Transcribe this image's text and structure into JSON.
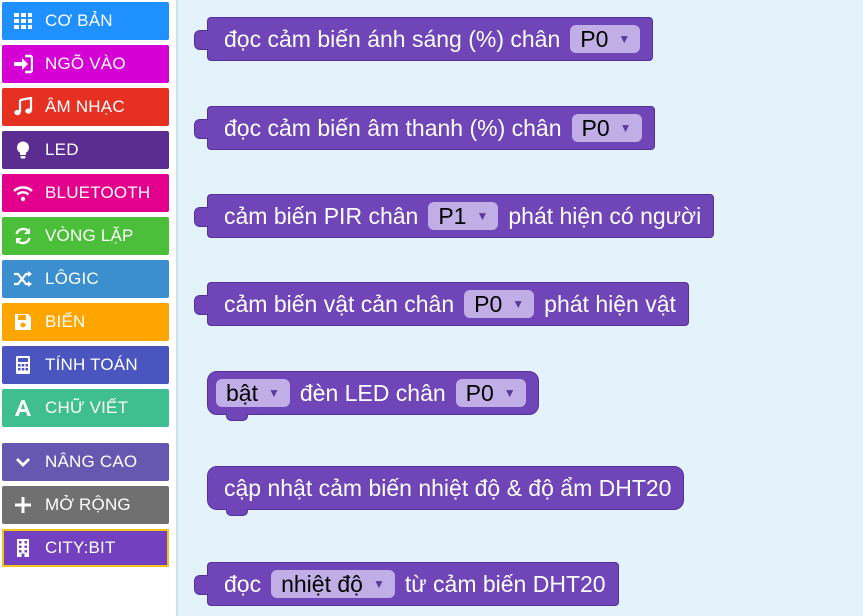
{
  "categories": [
    {
      "label": "CƠ BẢN",
      "icon": "grid-icon",
      "color": "#1e90ff"
    },
    {
      "label": "NGÕ VÀO",
      "icon": "sign-in-icon",
      "color": "#d400d4"
    },
    {
      "label": "ÂM NHẠC",
      "icon": "music-note-icon",
      "color": "#e63022"
    },
    {
      "label": "LED",
      "icon": "lightbulb-icon",
      "color": "#5c2d91"
    },
    {
      "label": "BLUETOOTH",
      "icon": "wifi-icon",
      "color": "#e3008c"
    },
    {
      "label": "VÒNG LẶP",
      "icon": "refresh-icon",
      "color": "#4cbf3a"
    },
    {
      "label": "LÔGIC",
      "icon": "shuffle-icon",
      "color": "#3c8fce"
    },
    {
      "label": "BIẾN",
      "icon": "save-icon",
      "color": "#ffa500"
    },
    {
      "label": "TÍNH TOÁN",
      "icon": "calculator-icon",
      "color": "#4a55c0"
    },
    {
      "label": "CHỮ VIẾT",
      "icon": "letter-a-icon",
      "color": "#3fbf8f"
    },
    {
      "label": "NÂNG CAO",
      "icon": "chevron-down-icon",
      "color": "#6658b0"
    },
    {
      "label": "MỞ RỘNG",
      "icon": "plus-icon",
      "color": "#707070"
    },
    {
      "label": "CITY:BIT",
      "icon": "building-icon",
      "color": "#7340c0",
      "selected": true
    }
  ],
  "blocks": {
    "light": {
      "text": "đọc cảm biến ánh sáng (%) chân",
      "pin": "P0"
    },
    "sound": {
      "text": "đọc cảm biến âm thanh (%) chân",
      "pin": "P0"
    },
    "pir": {
      "text1": "cảm biến PIR chân",
      "pin": "P1",
      "text2": "phát hiện có người"
    },
    "obstacle": {
      "text1": "cảm biến vật cản chân",
      "pin": "P0",
      "text2": "phát hiện vật"
    },
    "led": {
      "state": "bật",
      "text": "đèn LED chân",
      "pin": "P0"
    },
    "dht_update": {
      "text": "cập nhật cảm biến nhiệt độ & độ ẩm DHT20"
    },
    "dht_read": {
      "text1": "đọc",
      "field": "nhiệt độ",
      "text2": "từ cảm biến DHT20"
    }
  }
}
